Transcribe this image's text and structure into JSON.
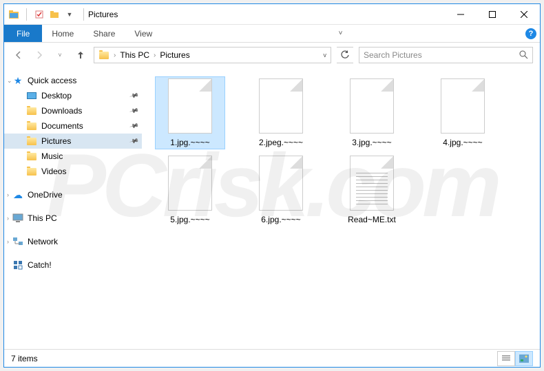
{
  "titlebar": {
    "title": "Pictures"
  },
  "ribbon": {
    "file": "File",
    "tabs": [
      "Home",
      "Share",
      "View"
    ]
  },
  "navbar": {
    "breadcrumb": [
      "This PC",
      "Pictures"
    ],
    "search_placeholder": "Search Pictures"
  },
  "sidebar": {
    "quick_access": "Quick access",
    "qa_items": [
      {
        "label": "Desktop",
        "icon": "desktop",
        "pinned": true
      },
      {
        "label": "Downloads",
        "icon": "folder",
        "pinned": true
      },
      {
        "label": "Documents",
        "icon": "folder",
        "pinned": true
      },
      {
        "label": "Pictures",
        "icon": "folder",
        "pinned": true,
        "selected": true
      },
      {
        "label": "Music",
        "icon": "folder",
        "pinned": false
      },
      {
        "label": "Videos",
        "icon": "folder",
        "pinned": false
      }
    ],
    "onedrive": "OneDrive",
    "thispc": "This PC",
    "network": "Network",
    "catch": "Catch!"
  },
  "files": [
    {
      "name": "1.jpg.~~~~",
      "type": "file",
      "selected": true
    },
    {
      "name": "2.jpeg.~~~~",
      "type": "file"
    },
    {
      "name": "3.jpg.~~~~",
      "type": "file"
    },
    {
      "name": "4.jpg.~~~~",
      "type": "file"
    },
    {
      "name": "5.jpg.~~~~",
      "type": "file"
    },
    {
      "name": "6.jpg.~~~~",
      "type": "file"
    },
    {
      "name": "Read~ME.txt",
      "type": "txt"
    }
  ],
  "statusbar": {
    "count": "7 items"
  },
  "watermark": "PCrisk.com"
}
